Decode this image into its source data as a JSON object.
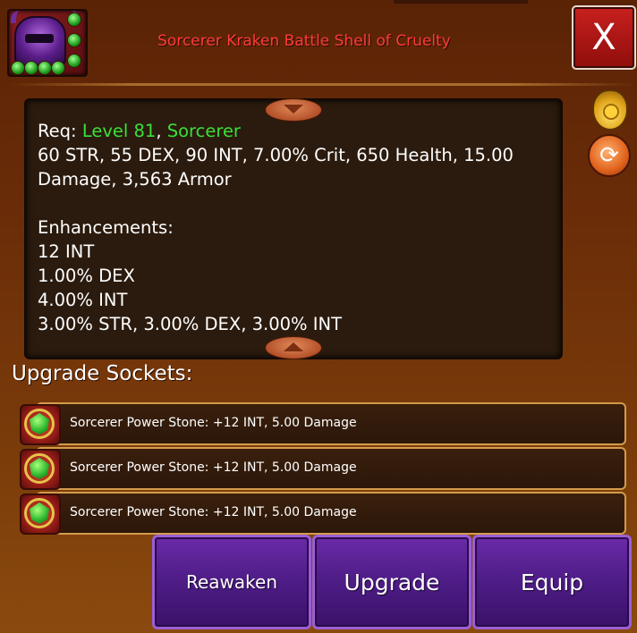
{
  "item": {
    "title": "Sorcerer Kraken Battle Shell of Cruelty",
    "icon": "purple-helmet-icon"
  },
  "close_label": "X",
  "description": {
    "req_label": "Req: ",
    "req_level": "Level 81",
    "req_sep": ", ",
    "req_class": "Sorcerer",
    "stats_line1": "60 STR, 55 DEX, 90 INT, 7.00% Crit, 650 Health, 15.00",
    "stats_line2": "Damage, 3,563 Armor",
    "enh_title": "Enhancements:",
    "enhancements": [
      "12 INT",
      "1.00% DEX",
      "4.00% INT",
      "3.00% STR, 3.00% DEX, 3.00% INT"
    ]
  },
  "side_icons": [
    "coin-bag-icon",
    "swap-icon"
  ],
  "sockets": {
    "title": "Upgrade Sockets:",
    "items": [
      {
        "label": "Sorcerer Power Stone: +12 INT, 5.00 Damage"
      },
      {
        "label": "Sorcerer Power Stone: +12 INT, 5.00 Damage"
      },
      {
        "label": "Sorcerer Power Stone: +12 INT, 5.00 Damage"
      }
    ]
  },
  "buttons": {
    "reawaken": "Reawaken",
    "upgrade": "Upgrade",
    "equip": "Equip"
  },
  "colors": {
    "title": "#ff3b3b",
    "requirement": "#39e039",
    "button_bg": "#4d1c85"
  }
}
